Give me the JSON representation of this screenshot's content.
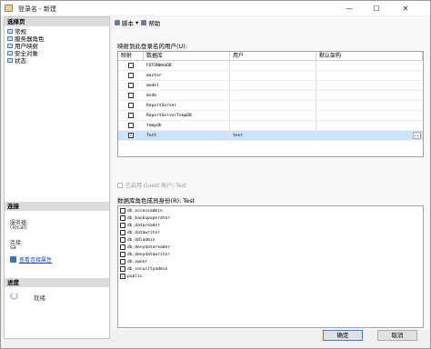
{
  "window": {
    "title": "登录名 - 新建"
  },
  "left": {
    "select_page_header": "选择页",
    "pages": [
      {
        "label": "常规"
      },
      {
        "label": "服务器角色"
      },
      {
        "label": "用户映射"
      },
      {
        "label": "安全对象"
      },
      {
        "label": "状态"
      }
    ],
    "connection_header": "连接",
    "server_label": "服务器:",
    "server_value": "(local)",
    "user_label": "连接:",
    "user_value": "sa",
    "view_connection_link": "查看连接属性",
    "progress_header": "进度",
    "progress_status": "就绪"
  },
  "toolbar": {
    "script_label": "脚本",
    "help_label": "帮助"
  },
  "user_mapping": {
    "label": "映射到此登录名的用户(U):",
    "columns": [
      "映射",
      "数据库",
      "用户",
      "默认架构"
    ],
    "rows": [
      {
        "db": "FOTONWebDB",
        "user": "",
        "checked": false
      },
      {
        "db": "master",
        "user": "",
        "checked": false
      },
      {
        "db": "model",
        "user": "",
        "checked": false
      },
      {
        "db": "msdb",
        "user": "",
        "checked": false
      },
      {
        "db": "ReportServer",
        "user": "",
        "checked": false
      },
      {
        "db": "ReportServerTempDB",
        "user": "",
        "checked": false
      },
      {
        "db": "tempdb",
        "user": "",
        "checked": false
      },
      {
        "db": "Test",
        "user": "test",
        "checked": true
      }
    ],
    "check_mark": "✓",
    "ellipsis": "..."
  },
  "guest": {
    "label": "已启用 Guest 帐户: Test"
  },
  "roles": {
    "label": "数据库角色成员身份(R): Test",
    "items": [
      {
        "name": "db_accessadmin",
        "checked": false
      },
      {
        "name": "db_backupoperator",
        "checked": false
      },
      {
        "name": "db_datareader",
        "checked": false
      },
      {
        "name": "db_datawriter",
        "checked": false
      },
      {
        "name": "db_ddladmin",
        "checked": false
      },
      {
        "name": "db_denydatareader",
        "checked": false
      },
      {
        "name": "db_denydatawriter",
        "checked": false
      },
      {
        "name": "db_owner",
        "checked": false
      },
      {
        "name": "db_securityadmin",
        "checked": false
      },
      {
        "name": "public",
        "checked": true
      }
    ]
  },
  "buttons": {
    "ok": "确定",
    "cancel": "取消"
  },
  "window_controls": {
    "minimize": "—",
    "maximize": "☐",
    "close": "✕"
  }
}
